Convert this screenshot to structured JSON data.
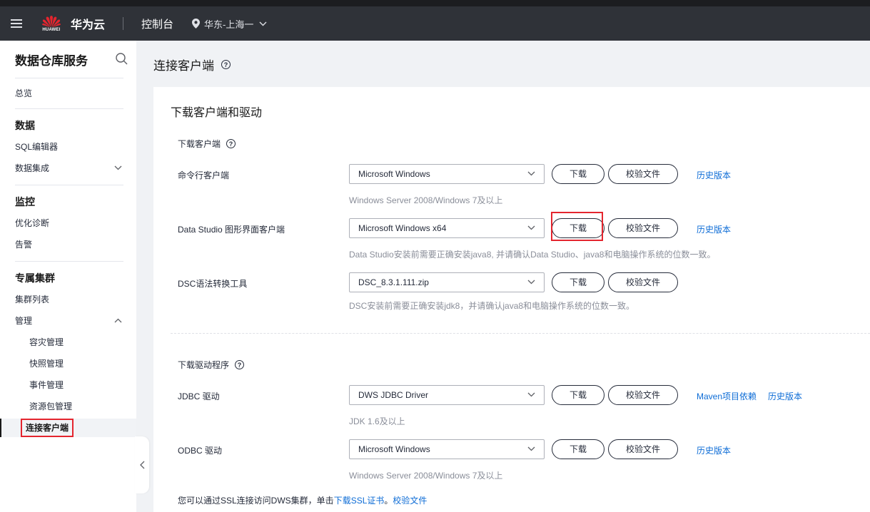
{
  "topbar": {
    "logo_text": "HUAWEI",
    "brand": "华为云",
    "console": "控制台",
    "region": "华东-上海一",
    "icons": [
      "menu-icon",
      "huawei-logo",
      "location-pin-icon",
      "chevron-down-icon"
    ]
  },
  "sidebar": {
    "title": "数据仓库服务",
    "overview": "总览",
    "groups": {
      "data": "数据",
      "monitor": "监控",
      "cluster": "专属集群"
    },
    "items": {
      "sql_editor": "SQL编辑器",
      "data_integration": "数据集成",
      "optimize": "优化诊断",
      "alarm": "告警",
      "cluster_list": "集群列表",
      "manage": "管理",
      "disaster": "容灾管理",
      "snapshot": "快照管理",
      "event": "事件管理",
      "resource_pkg": "资源包管理",
      "connect_client": "连接客户端"
    }
  },
  "page": {
    "title": "连接客户端",
    "card_title": "下载客户端和驱动",
    "client_section": "下载客户端",
    "driver_section": "下载驱动程序",
    "download_label": "下载",
    "verify_label": "校验文件",
    "history_label": "历史版本",
    "maven_label": "Maven项目依赖",
    "rows": {
      "cli": {
        "label": "命令行客户端",
        "selected": "Microsoft Windows",
        "hint": "Windows Server 2008/Windows 7及以上"
      },
      "data_studio": {
        "label": "Data Studio 图形界面客户端",
        "selected": "Microsoft Windows x64",
        "hint": "Data Studio安装前需要正确安装java8, 并请确认Data Studio、java8和电脑操作系统的位数一致。"
      },
      "dsc": {
        "label": "DSC语法转换工具",
        "selected": "DSC_8.3.1.111.zip",
        "hint": "DSC安装前需要正确安装jdk8，并请确认java8和电脑操作系统的位数一致。"
      },
      "jdbc": {
        "label": "JDBC 驱动",
        "selected": "DWS JDBC Driver",
        "hint": "JDK 1.6及以上"
      },
      "odbc": {
        "label": "ODBC 驱动",
        "selected": "Microsoft Windows",
        "hint": "Windows Server 2008/Windows 7及以上"
      }
    },
    "ssl": {
      "prefix": "您可以通过SSL连接访问DWS集群，单击",
      "link1": "下载SSL证书",
      "sep": "。",
      "link2": "校验文件"
    }
  },
  "colors": {
    "topbar_bg": "#2f3238",
    "link": "#0d6cd6",
    "highlight_border": "#e4252e",
    "hint_text": "#8a8e99"
  }
}
